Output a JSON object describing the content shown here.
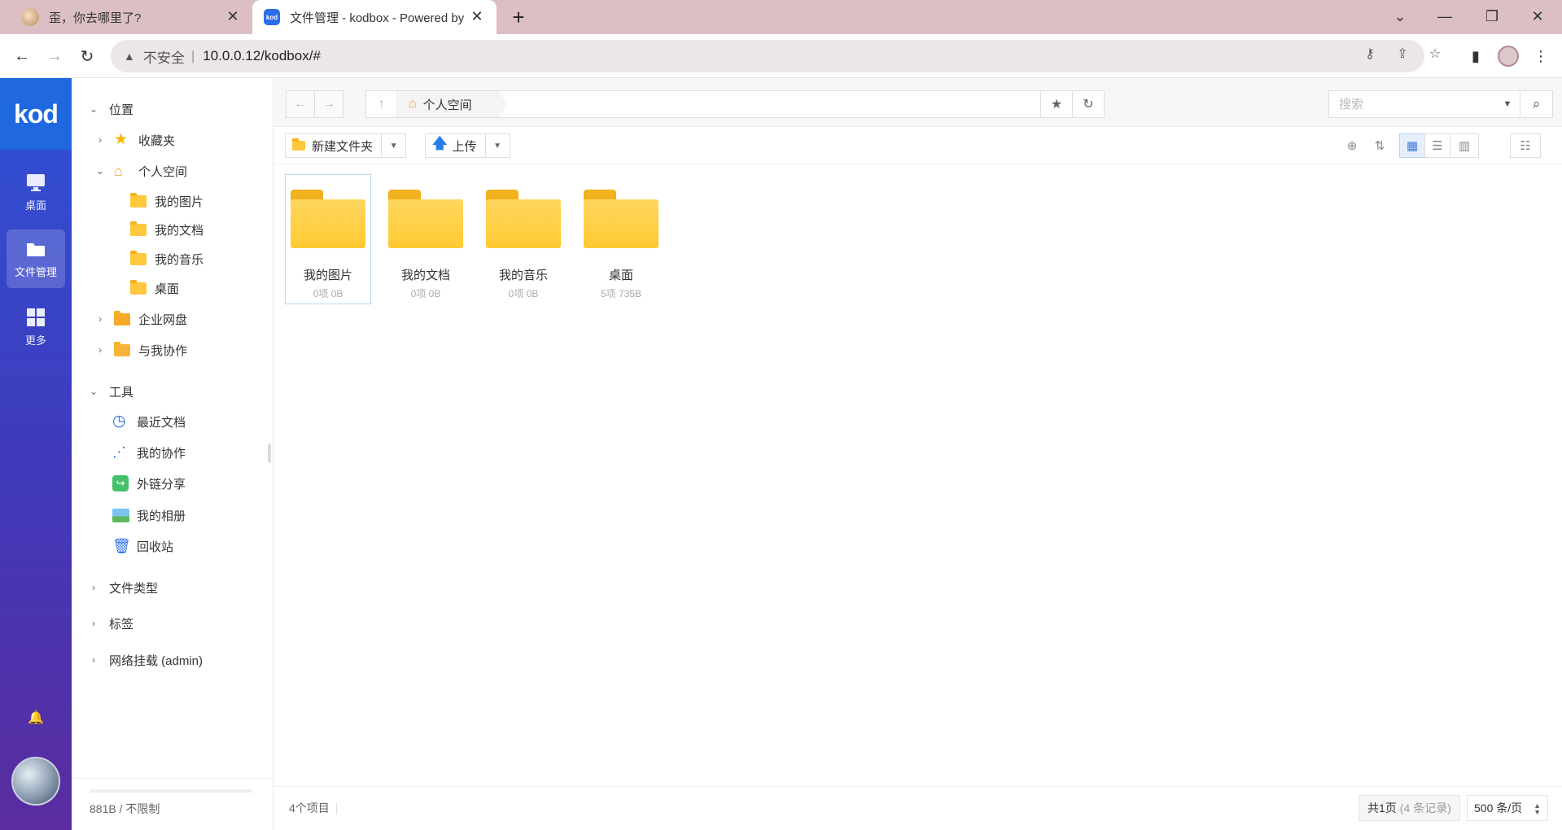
{
  "browser": {
    "tabs": [
      {
        "title": "歪，你去哪里了?",
        "active": false
      },
      {
        "title": "文件管理 - kodbox - Powered by",
        "active": true
      }
    ],
    "security_label": "不安全",
    "url": "10.0.0.12/kodbox/#"
  },
  "rail": {
    "logo": "kod",
    "items": [
      {
        "label": "桌面",
        "icon": "desktop-icon"
      },
      {
        "label": "文件管理",
        "icon": "folder-icon",
        "active": true
      },
      {
        "label": "更多",
        "icon": "grid-icon"
      }
    ]
  },
  "tree": {
    "location_header": "位置",
    "favorites": "收藏夹",
    "personal_space": "个人空间",
    "personal_children": [
      "我的图片",
      "我的文档",
      "我的音乐",
      "桌面"
    ],
    "enterprise_drive": "企业网盘",
    "shared_with_me": "与我协作",
    "tools_header": "工具",
    "tools": [
      "最近文档",
      "我的协作",
      "外链分享",
      "我的相册",
      "回收站"
    ],
    "file_types": "文件类型",
    "tags": "标签",
    "network_mount": "网络挂载 (admin)",
    "quota": "881B / 不限制"
  },
  "main": {
    "breadcrumb": "个人空间",
    "search_placeholder": "搜索",
    "new_folder_label": "新建文件夹",
    "upload_label": "上传",
    "files": [
      {
        "name": "我的图片",
        "meta": "0项  0B",
        "selected": true
      },
      {
        "name": "我的文档",
        "meta": "0项  0B",
        "selected": false
      },
      {
        "name": "我的音乐",
        "meta": "0项  0B",
        "selected": false
      },
      {
        "name": "桌面",
        "meta": "5项  735B",
        "selected": false
      }
    ],
    "item_count": "4个项目",
    "pager_total": "共1页",
    "pager_records": "(4 条记录)",
    "per_page": "500 条/页"
  },
  "colors": {
    "rail_top": "#2f52d6",
    "rail_bottom": "#5a2c9f",
    "folder": "#ffc933",
    "accent": "#3c7be0"
  }
}
